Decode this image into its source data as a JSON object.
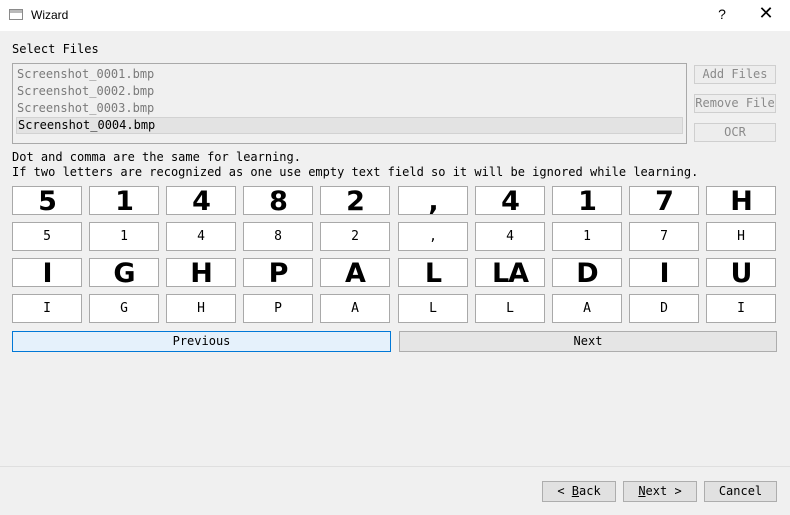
{
  "window": {
    "title": "Wizard",
    "help": "?",
    "close": "✕"
  },
  "select_files_label": "Select Files",
  "files": [
    {
      "name": "Screenshot_0001.bmp",
      "selected": false
    },
    {
      "name": "Screenshot_0002.bmp",
      "selected": false
    },
    {
      "name": "Screenshot_0003.bmp",
      "selected": false
    },
    {
      "name": "Screenshot_0004.bmp",
      "selected": true
    }
  ],
  "side_buttons": {
    "add_files": "Add Files",
    "remove_file": "Remove File",
    "ocr": "OCR"
  },
  "instructions": {
    "line1": "Dot and comma are the same for learning.",
    "line2": "If two letters are recognized as one use empty text field so it will be ignored while learning."
  },
  "glyph_rows": [
    {
      "glyphs": [
        "5",
        "1",
        "4",
        "8",
        "2",
        ",",
        "4",
        "1",
        "7",
        "H"
      ],
      "values": [
        "5",
        "1",
        "4",
        "8",
        "2",
        ",",
        "4",
        "1",
        "7",
        "H"
      ]
    },
    {
      "glyphs": [
        "I",
        "G",
        "H",
        "P",
        "A",
        "L",
        "LA",
        "D",
        "I",
        "U"
      ],
      "values": [
        "I",
        "G",
        "H",
        "P",
        "A",
        "L",
        "L",
        "A",
        "D",
        "I"
      ]
    }
  ],
  "pager": {
    "previous": "Previous",
    "next": "Next"
  },
  "footer": {
    "back_prefix": "< ",
    "back_key": "B",
    "back_rest": "ack",
    "next_key": "N",
    "next_rest": "ext >",
    "cancel": "Cancel"
  }
}
